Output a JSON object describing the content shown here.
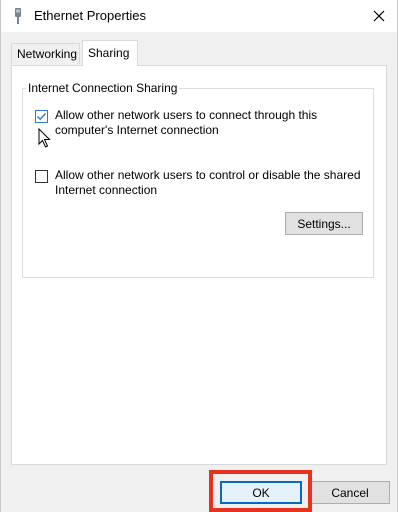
{
  "window": {
    "title": "Ethernet Properties",
    "icon": "ethernet-adapter-icon",
    "close_icon": "close-icon"
  },
  "tabs": [
    {
      "label": "Networking",
      "selected": false
    },
    {
      "label": "Sharing",
      "selected": true
    }
  ],
  "sharing": {
    "group_title": "Internet Connection Sharing",
    "option1": {
      "label": "Allow other network users to connect through this computer's Internet connection",
      "checked": true
    },
    "option2": {
      "label": "Allow other network users to control or disable the shared Internet connection",
      "checked": false
    },
    "settings_label": "Settings..."
  },
  "footer": {
    "ok_label": "OK",
    "cancel_label": "Cancel"
  },
  "colors": {
    "highlight": "#e8321f",
    "accent": "#0a67c3"
  }
}
